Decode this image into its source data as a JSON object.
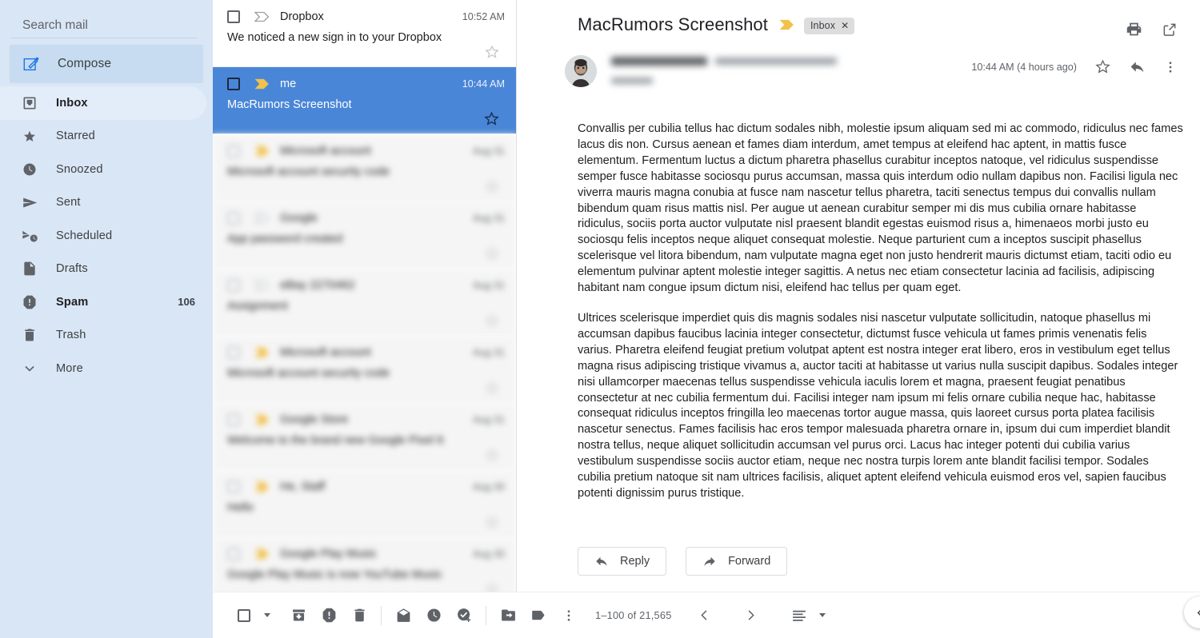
{
  "sidebar": {
    "search": {
      "placeholder": "Search mail",
      "value": ""
    },
    "compose_label": "Compose",
    "items": [
      {
        "label": "Inbox",
        "icon": "inbox-icon",
        "count": "",
        "active": true,
        "bold": true
      },
      {
        "label": "Starred",
        "icon": "star-icon",
        "count": "",
        "active": false,
        "bold": false
      },
      {
        "label": "Snoozed",
        "icon": "clock-icon",
        "count": "",
        "active": false,
        "bold": false
      },
      {
        "label": "Sent",
        "icon": "send-icon",
        "count": "",
        "active": false,
        "bold": false
      },
      {
        "label": "Scheduled",
        "icon": "scheduled-icon",
        "count": "",
        "active": false,
        "bold": false
      },
      {
        "label": "Drafts",
        "icon": "document-icon",
        "count": "",
        "active": false,
        "bold": false
      },
      {
        "label": "Spam",
        "icon": "spam-icon",
        "count": "106",
        "active": false,
        "bold": true
      },
      {
        "label": "Trash",
        "icon": "trash-icon",
        "count": "",
        "active": false,
        "bold": false
      },
      {
        "label": "More",
        "icon": "chevron-down-icon",
        "count": "",
        "active": false,
        "bold": false
      }
    ]
  },
  "mail_list": {
    "rows": [
      {
        "sender": "Dropbox",
        "subject": "We noticed a new sign in to your Dropbox",
        "time": "10:52 AM",
        "state": "read",
        "important": false,
        "redacted": false,
        "starred": false
      },
      {
        "sender": "me",
        "subject": "MacRumors Screenshot",
        "time": "10:44 AM",
        "state": "selected",
        "important": true,
        "redacted": false,
        "starred": false
      },
      {
        "sender": "Microsoft account",
        "subject": "Microsoft account security code",
        "time": "Aug 31",
        "state": "read",
        "important": true,
        "redacted": true,
        "starred": false
      },
      {
        "sender": "Google",
        "subject": "App password created",
        "time": "Aug 31",
        "state": "read",
        "important": false,
        "redacted": true,
        "starred": false
      },
      {
        "sender": "eBay 2270462",
        "subject": "Assignment",
        "time": "Aug 31",
        "state": "read",
        "important": false,
        "redacted": true,
        "starred": false
      },
      {
        "sender": "Microsoft account",
        "subject": "Microsoft account security code",
        "time": "Aug 31",
        "state": "read",
        "important": true,
        "redacted": true,
        "starred": false
      },
      {
        "sender": "Google Store",
        "subject": "Welcome to the brand new Google Pixel 6",
        "time": "Aug 31",
        "state": "read",
        "important": true,
        "redacted": true,
        "starred": false
      },
      {
        "sender": "He, Staff",
        "subject": "Hello",
        "time": "Aug 30",
        "state": "read",
        "important": true,
        "redacted": true,
        "starred": false
      },
      {
        "sender": "Google Play Music",
        "subject": "Google Play Music is now YouTube Music",
        "time": "Aug 30",
        "state": "read",
        "important": true,
        "redacted": true,
        "starred": false
      }
    ]
  },
  "reading_pane": {
    "subject": "MacRumors Screenshot",
    "label_chip": "Inbox",
    "label_chip_close": "✕",
    "header_actions": [
      {
        "name": "print-icon",
        "title": "Print all"
      },
      {
        "name": "open-in-new-icon",
        "title": "In new window"
      }
    ],
    "sender_name": "",
    "sender_email": "",
    "sender_to": "",
    "timestamp": "10:44 AM (4 hours ago)",
    "message_actions": [
      {
        "name": "star-icon",
        "title": "Star"
      },
      {
        "name": "reply-icon",
        "title": "Reply"
      },
      {
        "name": "more-vert-icon",
        "title": "More"
      }
    ],
    "body_paragraphs": [
      "Convallis per cubilia tellus hac dictum sodales nibh, molestie ipsum aliquam sed mi ac commodo, ridiculus nec fames lacus dis non. Cursus aenean et fames diam interdum, amet tempus at eleifend hac aptent, in mattis fusce elementum. Fermentum luctus a dictum pharetra phasellus curabitur inceptos natoque, vel ridiculus suspendisse semper fusce habitasse sociosqu purus accumsan, massa quis interdum odio nullam dapibus non. Facilisi ligula nec viverra mauris magna conubia at fusce nam nascetur tellus pharetra, taciti senectus tempus dui convallis nullam bibendum quam risus mattis nisl. Per augue ut aenean curabitur semper mi dis mus cubilia ornare habitasse ridiculus, sociis porta auctor vulputate nisl praesent blandit egestas euismod risus a, himenaeos morbi justo eu sociosqu felis inceptos neque aliquet consequat molestie. Neque parturient cum a inceptos suscipit phasellus scelerisque vel litora bibendum, nam vulputate magna eget non justo hendrerit mauris dictumst etiam, taciti odio eu elementum pulvinar aptent molestie integer sagittis. A netus nec etiam consectetur lacinia ad facilisis, adipiscing habitant nam congue ipsum dictum nisi, eleifend hac tellus per quam eget.",
      "Ultrices scelerisque imperdiet quis dis magnis sodales nisi nascetur vulputate sollicitudin, natoque phasellus mi accumsan dapibus faucibus lacinia integer consectetur, dictumst fusce vehicula ut fames primis venenatis felis varius. Pharetra eleifend feugiat pretium volutpat aptent est nostra integer erat libero, eros in vestibulum eget tellus magna risus adipiscing tristique vivamus a, auctor taciti at habitasse ut varius nulla suscipit dapibus. Sodales integer nisi ullamcorper maecenas tellus suspendisse vehicula iaculis lorem et magna, praesent feugiat penatibus consectetur at nec cubilia fermentum dui. Facilisi integer nam ipsum mi felis ornare cubilia neque hac, habitasse consequat ridiculus inceptos fringilla leo maecenas tortor augue massa, quis laoreet cursus porta platea facilisis nascetur senectus. Fames facilisis hac eros tempor malesuada pharetra ornare in, ipsum dui cum imperdiet blandit nostra tellus, neque aliquet sollicitudin accumsan vel purus orci. Lacus hac integer potenti dui cubilia varius vestibulum suspendisse sociis auctor etiam, neque nec nostra turpis lorem ante blandit facilisi tempor. Sodales cubilia pretium natoque sit nam ultrices facilisis, aliquet aptent eleifend vehicula euismod eros vel, sapien faucibus potenti dignissim purus tristique."
    ],
    "reply_label": "Reply",
    "forward_label": "Forward"
  },
  "toolbar": {
    "select_all": "select-all-checkbox",
    "buttons": [
      {
        "name": "archive-icon",
        "title": "Archive"
      },
      {
        "name": "report-spam-icon",
        "title": "Report spam"
      },
      {
        "name": "delete-icon",
        "title": "Delete"
      },
      {
        "name": "mark-unread-icon",
        "title": "Mark as unread"
      },
      {
        "name": "snooze-icon",
        "title": "Snooze"
      },
      {
        "name": "add-to-tasks-icon",
        "title": "Add to Tasks"
      },
      {
        "name": "move-to-icon",
        "title": "Move to"
      },
      {
        "name": "labels-icon",
        "title": "Labels"
      },
      {
        "name": "more-vert-icon",
        "title": "More"
      }
    ],
    "pagination": "1–100 of 21,565",
    "prev_title": "Newer",
    "next_title": "Older",
    "density_title": "Input tools"
  },
  "side_panel_toggle": "chevron-left-icon",
  "colors": {
    "sidebar_bg": "#d9e6f5",
    "nav_active_bg": "#e3edf9",
    "compose_bg": "#c7dcf0",
    "selected_row_bg": "#4a86d8",
    "important_marker": "#f2c14a",
    "text_primary": "#202124",
    "text_secondary": "#5f6368"
  }
}
